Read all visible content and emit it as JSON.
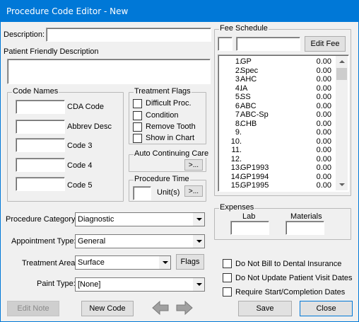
{
  "window": {
    "title": "Procedure Code Editor - New"
  },
  "description": {
    "label": "Description:",
    "value": ""
  },
  "patient_friendly": {
    "label": "Patient Friendly Description",
    "value": ""
  },
  "code_names": {
    "legend": "Code Names",
    "fields": [
      {
        "label": "CDA Code",
        "value": ""
      },
      {
        "label": "Abbrev Desc",
        "value": ""
      },
      {
        "label": "Code 3",
        "value": ""
      },
      {
        "label": "Code 4",
        "value": ""
      },
      {
        "label": "Code 5",
        "value": ""
      }
    ]
  },
  "treatment_flags": {
    "legend": "Treatment Flags",
    "items": [
      {
        "label": "Difficult Proc.",
        "checked": false
      },
      {
        "label": "Condition",
        "checked": false
      },
      {
        "label": "Remove Tooth",
        "checked": false
      },
      {
        "label": "Show in Chart",
        "checked": false
      }
    ]
  },
  "auto_continuing_care": {
    "legend": "Auto Continuing Care",
    "button": ">..."
  },
  "procedure_time": {
    "legend": "Procedure Time",
    "units_label": "Unit(s)",
    "value": "",
    "button": ">..."
  },
  "fee_schedule": {
    "legend": "Fee Schedule",
    "code_value": "",
    "desc_value": "",
    "edit_button": "Edit Fee",
    "rows": [
      {
        "num": "1.",
        "code": "GP",
        "amount": "0.00"
      },
      {
        "num": "2.",
        "code": "Spec",
        "amount": "0.00"
      },
      {
        "num": "3.",
        "code": "AHC",
        "amount": "0.00"
      },
      {
        "num": "4.",
        "code": "IA",
        "amount": "0.00"
      },
      {
        "num": "5.",
        "code": "SS",
        "amount": "0.00"
      },
      {
        "num": "6.",
        "code": "ABC",
        "amount": "0.00"
      },
      {
        "num": "7.",
        "code": "ABC-Sp",
        "amount": "0.00"
      },
      {
        "num": "8.",
        "code": "CHB",
        "amount": "0.00"
      },
      {
        "num": "9.",
        "code": "",
        "amount": "0.00"
      },
      {
        "num": "10.",
        "code": "",
        "amount": "0.00"
      },
      {
        "num": "11.",
        "code": "",
        "amount": "0.00"
      },
      {
        "num": "12.",
        "code": "",
        "amount": "0.00"
      },
      {
        "num": "13.",
        "code": "GP1993",
        "amount": "0.00"
      },
      {
        "num": "14.",
        "code": "GP1994",
        "amount": "0.00"
      },
      {
        "num": "15.",
        "code": "GP1995",
        "amount": "0.00"
      }
    ]
  },
  "expenses": {
    "legend": "Expenses",
    "lab_label": "Lab",
    "materials_label": "Materials",
    "lab_value": "",
    "materials_value": ""
  },
  "procedure_category": {
    "label": "Procedure Category:",
    "value": "Diagnostic"
  },
  "appointment_type": {
    "label": "Appointment Type:",
    "value": "General"
  },
  "treatment_area": {
    "label": "Treatment Area:",
    "value": "Surface",
    "flags_button": "Flags"
  },
  "paint_type": {
    "label": "Paint Type:",
    "value": "[None]"
  },
  "options": [
    {
      "label": "Do Not Bill to Dental Insurance",
      "checked": false
    },
    {
      "label": "Do Not Update Patient Visit Dates",
      "checked": false
    },
    {
      "label": "Require Start/Completion Dates",
      "checked": false
    }
  ],
  "buttons": {
    "edit_note": "Edit Note",
    "new_code": "New Code",
    "save": "Save",
    "close": "Close"
  },
  "colors": {
    "title_bar": "#0078d7",
    "window_bg": "#f0f0f0",
    "arrow_gray": "#9a9a9a"
  }
}
